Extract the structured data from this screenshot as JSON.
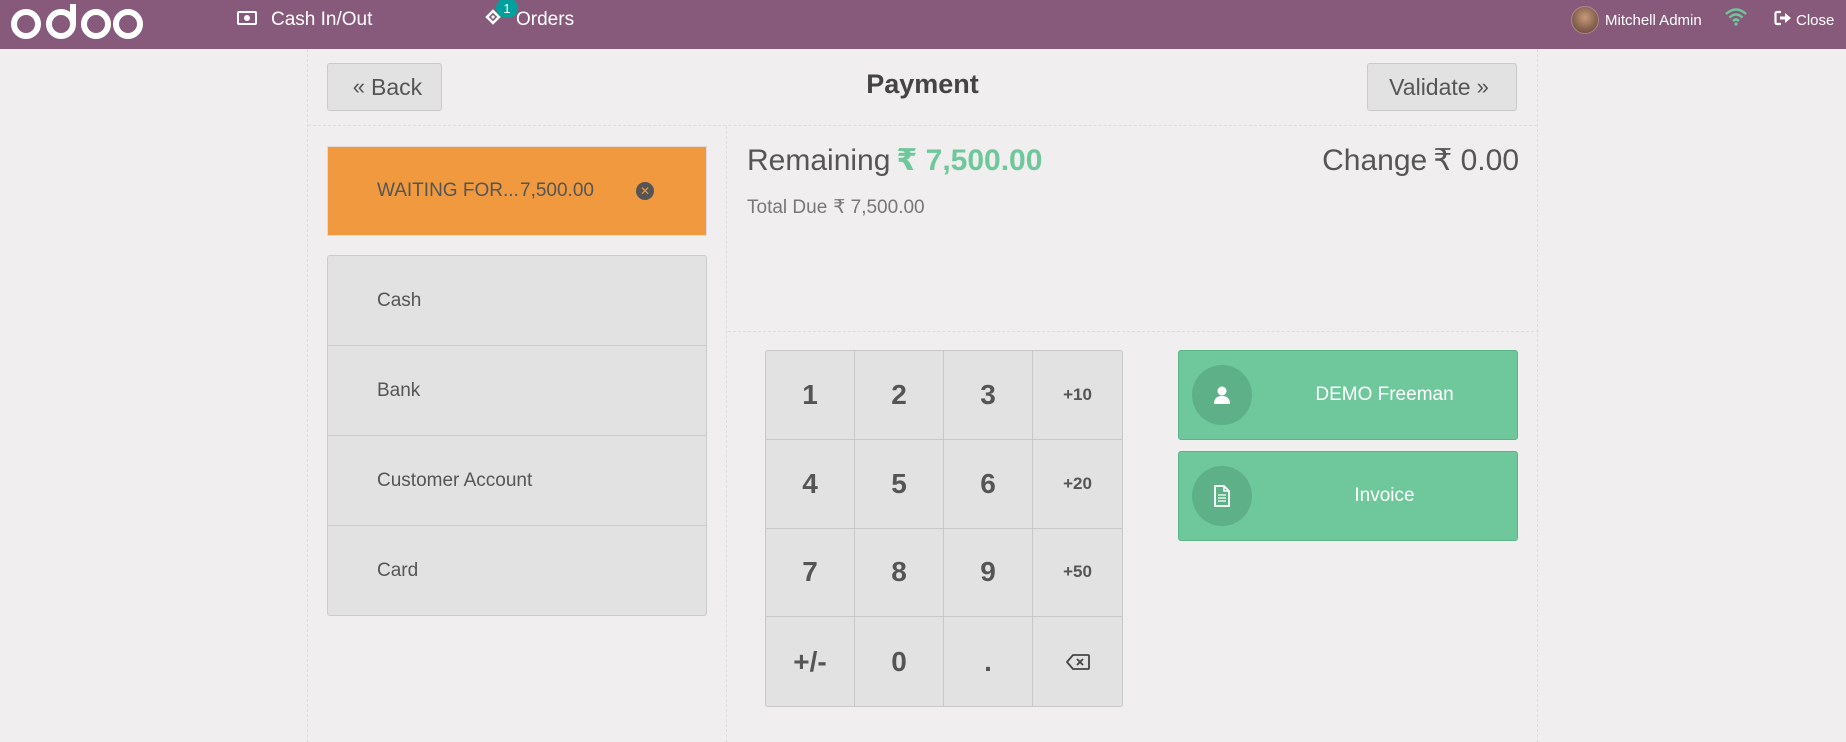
{
  "navbar": {
    "logo": "odoo",
    "cash_label": "Cash In/Out",
    "orders_label": "Orders",
    "orders_badge": "1",
    "user_name": "Mitchell Admin",
    "close_label": "Close",
    "color": "#875a7b"
  },
  "header": {
    "back_label": "Back",
    "title": "Payment",
    "validate_label": "Validate"
  },
  "paymentlines": [
    {
      "name": "WAITING FOR...",
      "amount": "7,500.00",
      "color": "#f0993f"
    }
  ],
  "payment_methods": [
    {
      "label": "Cash"
    },
    {
      "label": "Bank"
    },
    {
      "label": "Customer Account"
    },
    {
      "label": "Card"
    }
  ],
  "summary": {
    "remaining_label": "Remaining",
    "remaining_value": "₹ 7,500.00",
    "total_due_label": "Total Due",
    "total_due_value": "₹ 7,500.00",
    "change_label": "Change",
    "change_value": "₹ 0.00",
    "accent": "#6ec89b"
  },
  "numpad": {
    "keys": [
      "1",
      "2",
      "3",
      "+10",
      "4",
      "5",
      "6",
      "+20",
      "7",
      "8",
      "9",
      "+50",
      "+/-",
      "0",
      ".",
      "⌫"
    ]
  },
  "actions": {
    "customer_label": "DEMO Freeman",
    "invoice_label": "Invoice"
  }
}
